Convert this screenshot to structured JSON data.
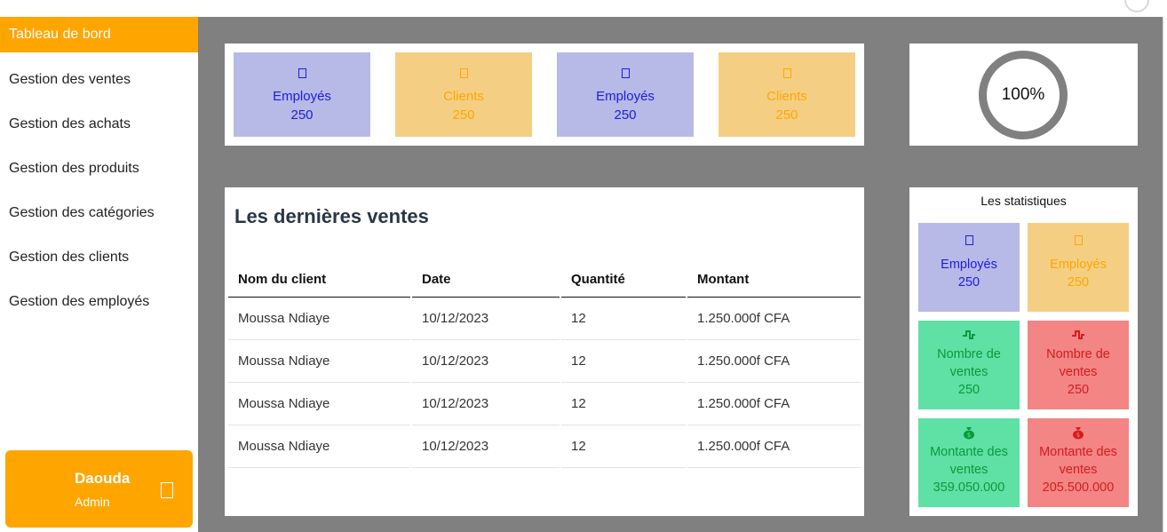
{
  "sidebar": {
    "items": [
      {
        "label": "Tableau de bord"
      },
      {
        "label": "Gestion des ventes"
      },
      {
        "label": "Gestion des achats"
      },
      {
        "label": "Gestion des produits"
      },
      {
        "label": "Gestion des catégories"
      },
      {
        "label": "Gestion des clients"
      },
      {
        "label": "Gestion des employés"
      }
    ],
    "profile": {
      "name": "Daouda",
      "role": "Admin",
      "icon": "logout-icon"
    }
  },
  "summary_cards": [
    {
      "label": "Employés",
      "value": "250",
      "icon": "employees-icon",
      "color": "#1c1ce0"
    },
    {
      "label": "Clients",
      "value": "250",
      "icon": "clients-icon",
      "color": "#ffa500"
    },
    {
      "label": "Employés",
      "value": "250",
      "icon": "employees-icon",
      "color": "#1c1ce0"
    },
    {
      "label": "Clients",
      "value": "250",
      "icon": "clients-icon",
      "color": "#ffa500"
    }
  ],
  "progress": {
    "label": "100%",
    "value": 1.0
  },
  "sales": {
    "title": "Les dernières ventes",
    "columns": [
      "Nom du client",
      "Date",
      "Quantité",
      "Montant"
    ],
    "rows": [
      [
        "Moussa Ndiaye",
        "10/12/2023",
        "12",
        "1.250.000f CFA"
      ],
      [
        "Moussa Ndiaye",
        "10/12/2023",
        "12",
        "1.250.000f CFA"
      ],
      [
        "Moussa Ndiaye",
        "10/12/2023",
        "12",
        "1.250.000f CFA"
      ],
      [
        "Moussa Ndiaye",
        "10/12/2023",
        "12",
        "1.250.000f CFA"
      ]
    ]
  },
  "stats": {
    "title": "Les statistiques",
    "cards": [
      {
        "label": "Employés",
        "value": "250",
        "icon": "employees-icon"
      },
      {
        "label": "Employés",
        "value": "250",
        "icon": "employees-icon"
      },
      {
        "label": "Nombre de ventes",
        "value": "250",
        "icon": "trend-up-icon"
      },
      {
        "label": "Nombre de ventes",
        "value": "250",
        "icon": "trend-down-icon"
      },
      {
        "label": "Montante des ventes",
        "value": "359.050.000",
        "icon": "money-bag-icon"
      },
      {
        "label": "Montante des ventes",
        "value": "205.500.000",
        "icon": "money-bag-icon"
      }
    ]
  },
  "colors": {
    "accent": "#ffa500",
    "main_bg": "#808080",
    "blue_card": "#b7b9e6",
    "orange_card": "#f4cf83",
    "green_card": "#5fe0a5",
    "red_card": "#f38585"
  }
}
